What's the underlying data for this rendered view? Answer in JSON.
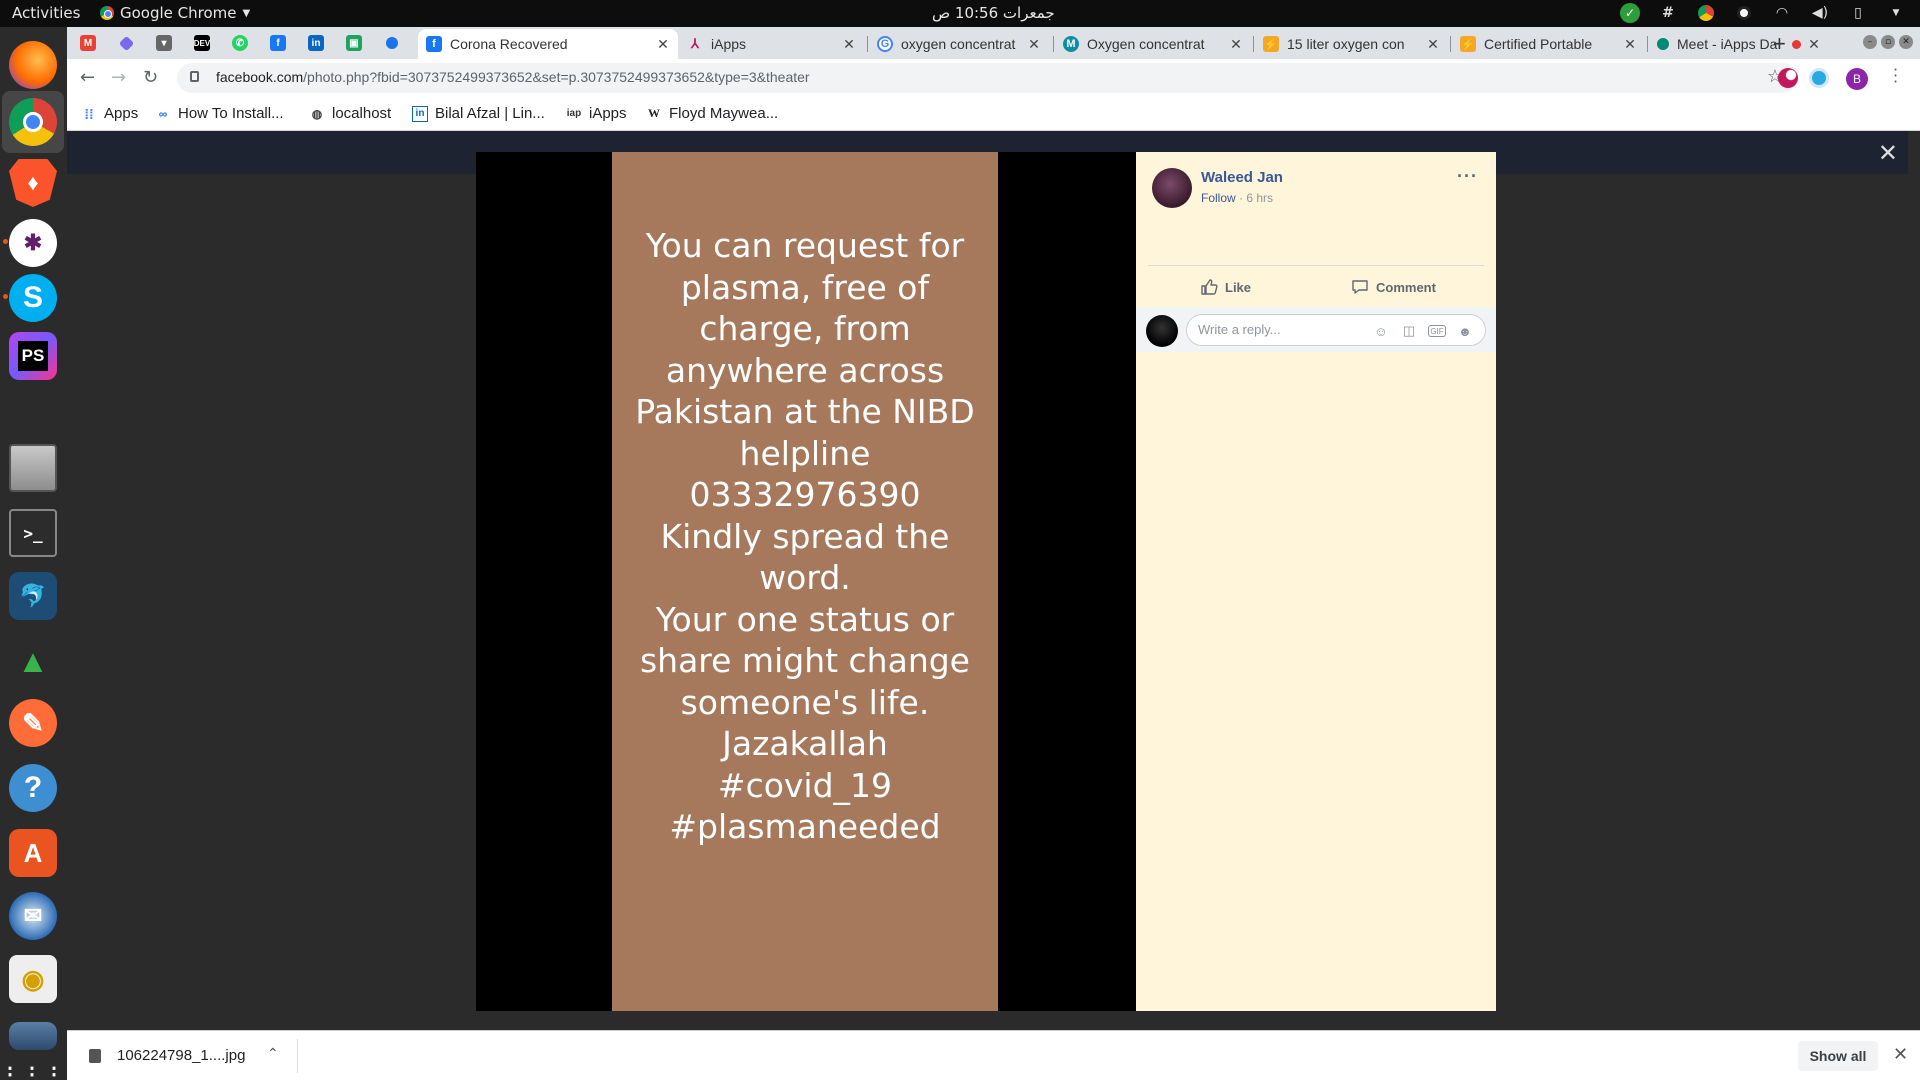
{
  "topbar": {
    "activities": "Activities",
    "app_name": "Google Chrome",
    "clock": "جمعرات 10:56 ص"
  },
  "dock": {
    "items": [
      "firefox-icon",
      "chrome-icon",
      "brave-icon",
      "slack-icon",
      "skype-icon",
      "phpstorm-icon",
      "files-icon",
      "terminal-icon",
      "mysql-workbench-icon",
      "rocket-icon",
      "postman-icon",
      "help-icon",
      "software-center-icon",
      "thunderbird-icon",
      "rhythmbox-icon",
      "removable-drive-icon",
      "show-apps-icon"
    ]
  },
  "tabs": [
    {
      "title": "Corona Recovered",
      "favicon": "facebook-icon",
      "active": true
    },
    {
      "title": "iApps",
      "favicon": "iapps-icon",
      "active": false
    },
    {
      "title": "oxygen concentrat",
      "favicon": "google-icon",
      "active": false
    },
    {
      "title": "Oxygen concentrat",
      "favicon": "m-icon",
      "active": false
    },
    {
      "title": "15 liter oxygen con",
      "favicon": "daraz-icon",
      "active": false
    },
    {
      "title": "Certified Portable",
      "favicon": "daraz-icon",
      "active": false
    },
    {
      "title": "Meet - iApps Da",
      "favicon": "meet-icon",
      "active": false
    }
  ],
  "toolbar": {
    "url_host": "facebook.com",
    "url_rest": "/photo.php?fbid=3073752499373652&set=p.3073752499373652&type=3&theater",
    "profile_letter": "B"
  },
  "bookmarks": [
    {
      "label": "Apps",
      "icon": "apps-grid-icon"
    },
    {
      "label": "How To Install...",
      "icon": "link-icon"
    },
    {
      "label": "localhost",
      "icon": "globe-icon"
    },
    {
      "label": "Bilal Afzal | Lin...",
      "icon": "linkedin-icon"
    },
    {
      "label": "iApps",
      "icon": "iapps-icon"
    },
    {
      "label": "Floyd Maywea...",
      "icon": "wikipedia-icon"
    }
  ],
  "photo": {
    "text": "You can request for\nplasma, free of\ncharge, from\nanywhere across\nPakistan at the NIBD\nhelpline\n03332976390\nKindly spread the\nword.\nYour one status or\nshare might change\nsomeone's life.\nJazakallah\n#covid_19\n#plasmaneeded",
    "background": "#a6785c"
  },
  "post": {
    "author": "Waleed Jan",
    "follow": "Follow",
    "separator": " · ",
    "time": "6 hrs",
    "like_label": "Like",
    "comment_label": "Comment",
    "reply_placeholder": "Write a reply..."
  },
  "downloads": {
    "file_name": "106224798_1....jpg",
    "show_all": "Show all"
  }
}
